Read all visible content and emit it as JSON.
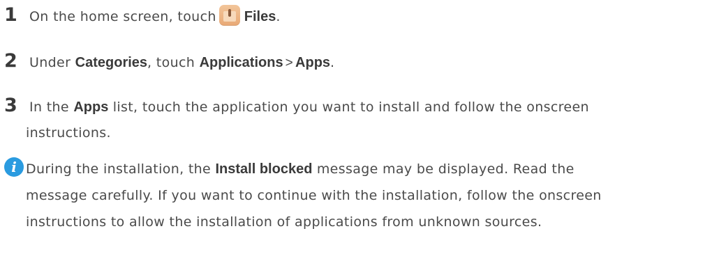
{
  "steps": [
    {
      "number": "1",
      "text_before": "On the home screen, touch",
      "icon": "files-app-icon",
      "bold": "Files",
      "text_after": "."
    },
    {
      "number": "2",
      "text_before": "Under",
      "bold1": "Categories",
      "text_mid": ", touch",
      "bold2": "Applications",
      "separator": ">",
      "bold3": "Apps",
      "text_after": "."
    },
    {
      "number": "3",
      "text_before": "In the",
      "bold": "Apps",
      "text_after": "list, touch the application you want to install and follow the onscreen",
      "line2": "instructions."
    }
  ],
  "note": {
    "icon": "info-icon",
    "icon_glyph": "i",
    "line1_before": "During the installation, the",
    "line1_bold": "Install blocked",
    "line1_after": "message may be displayed. Read the",
    "line2": "message carefully. If you want to continue with the installation, follow the onscreen",
    "line3": "instructions to allow the installation of applications from unknown sources."
  },
  "colors": {
    "text": "#4a4a4a",
    "bold_text": "#3a3a3a",
    "note_icon": "#2a9be0",
    "files_icon": "#e9a976"
  }
}
